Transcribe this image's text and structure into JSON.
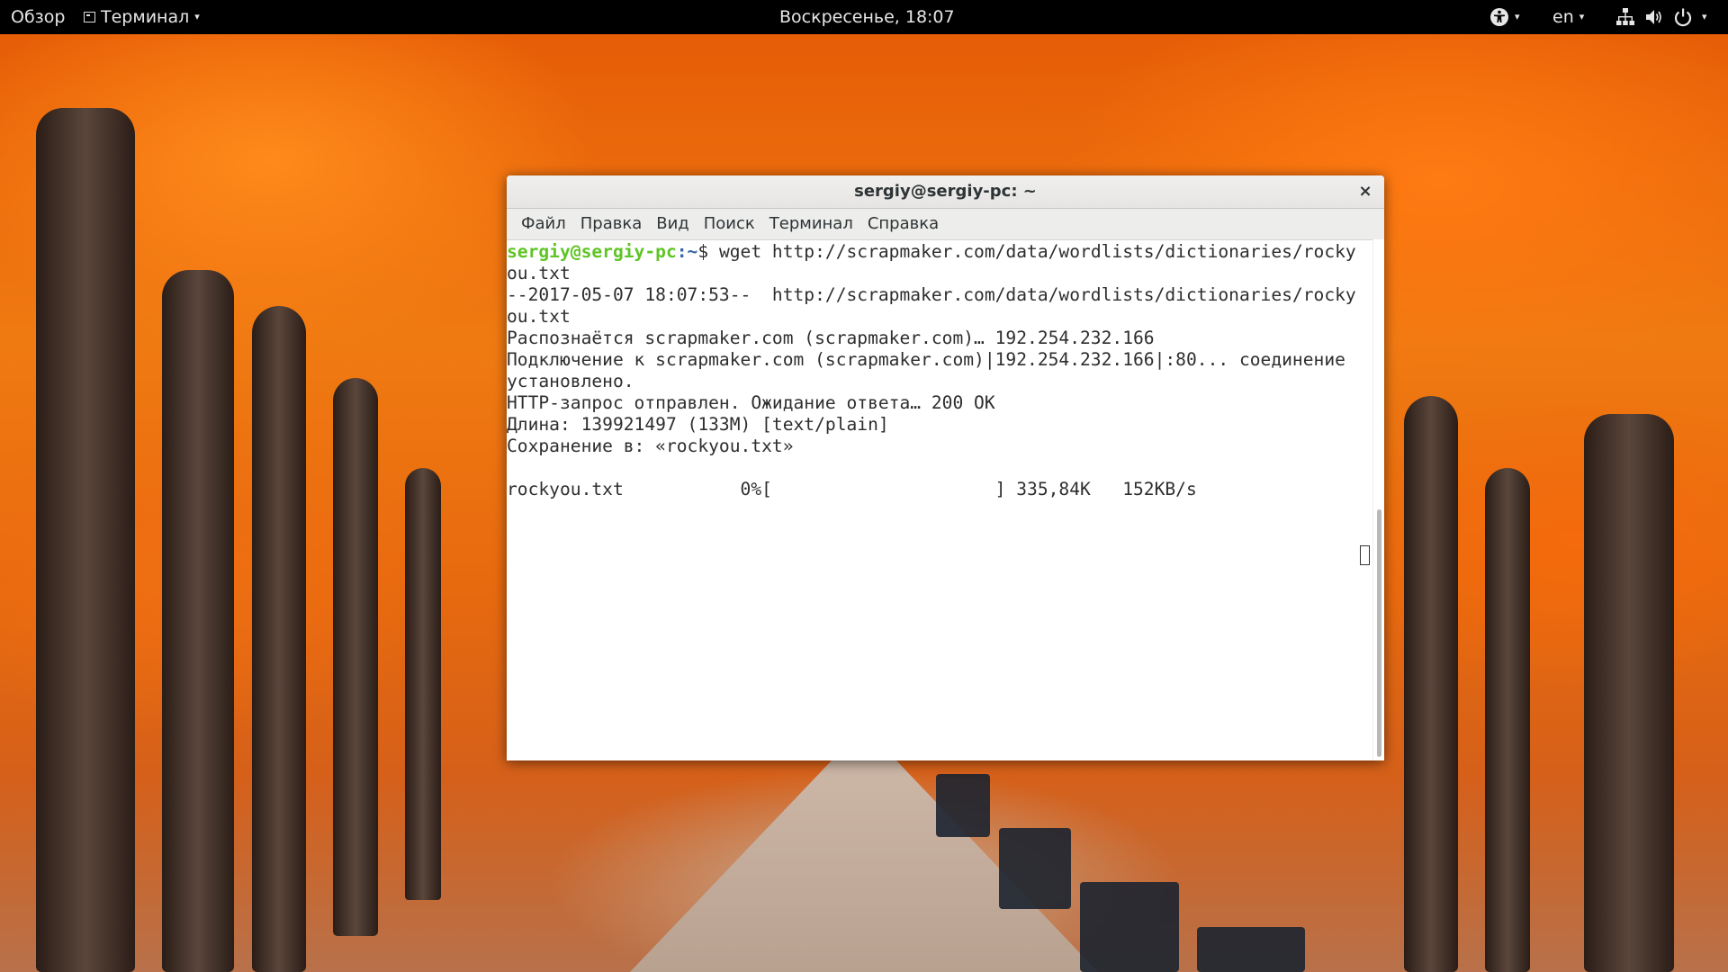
{
  "topbar": {
    "activities": "Обзор",
    "app_menu": "Терминал",
    "clock": "Воскресенье, 18:07",
    "language": "en"
  },
  "window": {
    "title": "sergiy@sergiy-pc: ~",
    "close_glyph": "×",
    "menu": [
      "Файл",
      "Правка",
      "Вид",
      "Поиск",
      "Терминал",
      "Справка"
    ]
  },
  "terminal": {
    "prompt_user": "sergiy@sergiy-pc",
    "prompt_path": ":~",
    "prompt_symbol": "$ ",
    "command": "wget http://scrapmaker.com/data/wordlists/dictionaries/rocky",
    "output": [
      "ou.txt",
      "--2017-05-07 18:07:53--  http://scrapmaker.com/data/wordlists/dictionaries/rocky",
      "ou.txt",
      "Распознаётся scrapmaker.com (scrapmaker.com)… 192.254.232.166",
      "Подключение к scrapmaker.com (scrapmaker.com)|192.254.232.166|:80... соединение",
      "установлено.",
      "HTTP-запрос отправлен. Ожидание ответа… 200 OK",
      "Длина: 139921497 (133M) [text/plain]",
      "Сохранение в: «rockyou.txt»",
      "",
      "rockyou.txt           0%[                     ] 335,84K   152KB/s"
    ]
  },
  "icons": {
    "accessibility": "accessibility-icon",
    "network": "network-icon",
    "volume": "volume-icon",
    "power": "power-icon"
  }
}
